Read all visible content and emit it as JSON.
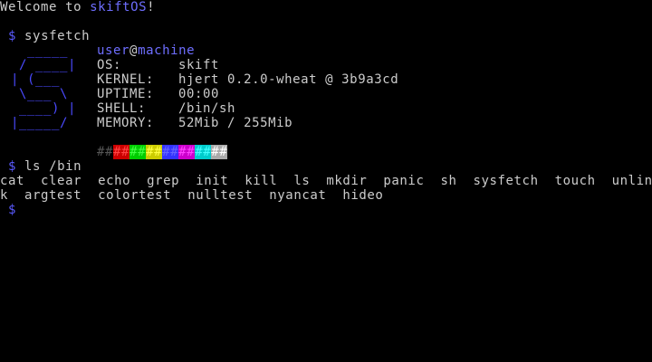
{
  "terminal": {
    "welcome_prefix": "Welcome to ",
    "welcome_os": "skiftOS",
    "welcome_suffix": "!",
    "prompt_symbol": "$",
    "command1": "sysfetch",
    "command2": "ls /bin",
    "colors": {
      "background": "#000000",
      "foreground": "#cccccc",
      "accent": "#5a5aff"
    }
  },
  "sysfetch": {
    "logo": [
      "  _____",
      " / ____|",
      "| (___",
      " \\___ \\",
      " ____) |",
      "|_____/"
    ],
    "user": "user",
    "at": "@",
    "host": "machine",
    "info": [
      {
        "key": "OS:",
        "value": "skift"
      },
      {
        "key": "KERNEL:",
        "value": "hjert 0.2.0-wheat @ 3b9a3cd"
      },
      {
        "key": "UPTIME:",
        "value": "00:00"
      },
      {
        "key": "SHELL:",
        "value": "/bin/sh"
      },
      {
        "key": "MEMORY:",
        "value": "52Mib / 255Mib"
      }
    ],
    "palette_glyph": "##",
    "palette": [
      {
        "fg": "#555555",
        "bg": "#000000"
      },
      {
        "fg": "#ff4444",
        "bg": "#cc0000"
      },
      {
        "fg": "#44ff44",
        "bg": "#00cc00"
      },
      {
        "fg": "#ffff44",
        "bg": "#cccc00"
      },
      {
        "fg": "#6666ff",
        "bg": "#3333ff"
      },
      {
        "fg": "#ff44ff",
        "bg": "#cc00cc"
      },
      {
        "fg": "#44ffff",
        "bg": "#00cccc"
      },
      {
        "fg": "#ffffff",
        "bg": "#aaaaaa"
      }
    ]
  },
  "ls_output": {
    "line1": "cat  clear  echo  grep  init  kill  ls  mkdir  panic  sh  sysfetch  touch  unlin",
    "line2": "k  argtest  colortest  nulltest  nyancat  hideo"
  }
}
